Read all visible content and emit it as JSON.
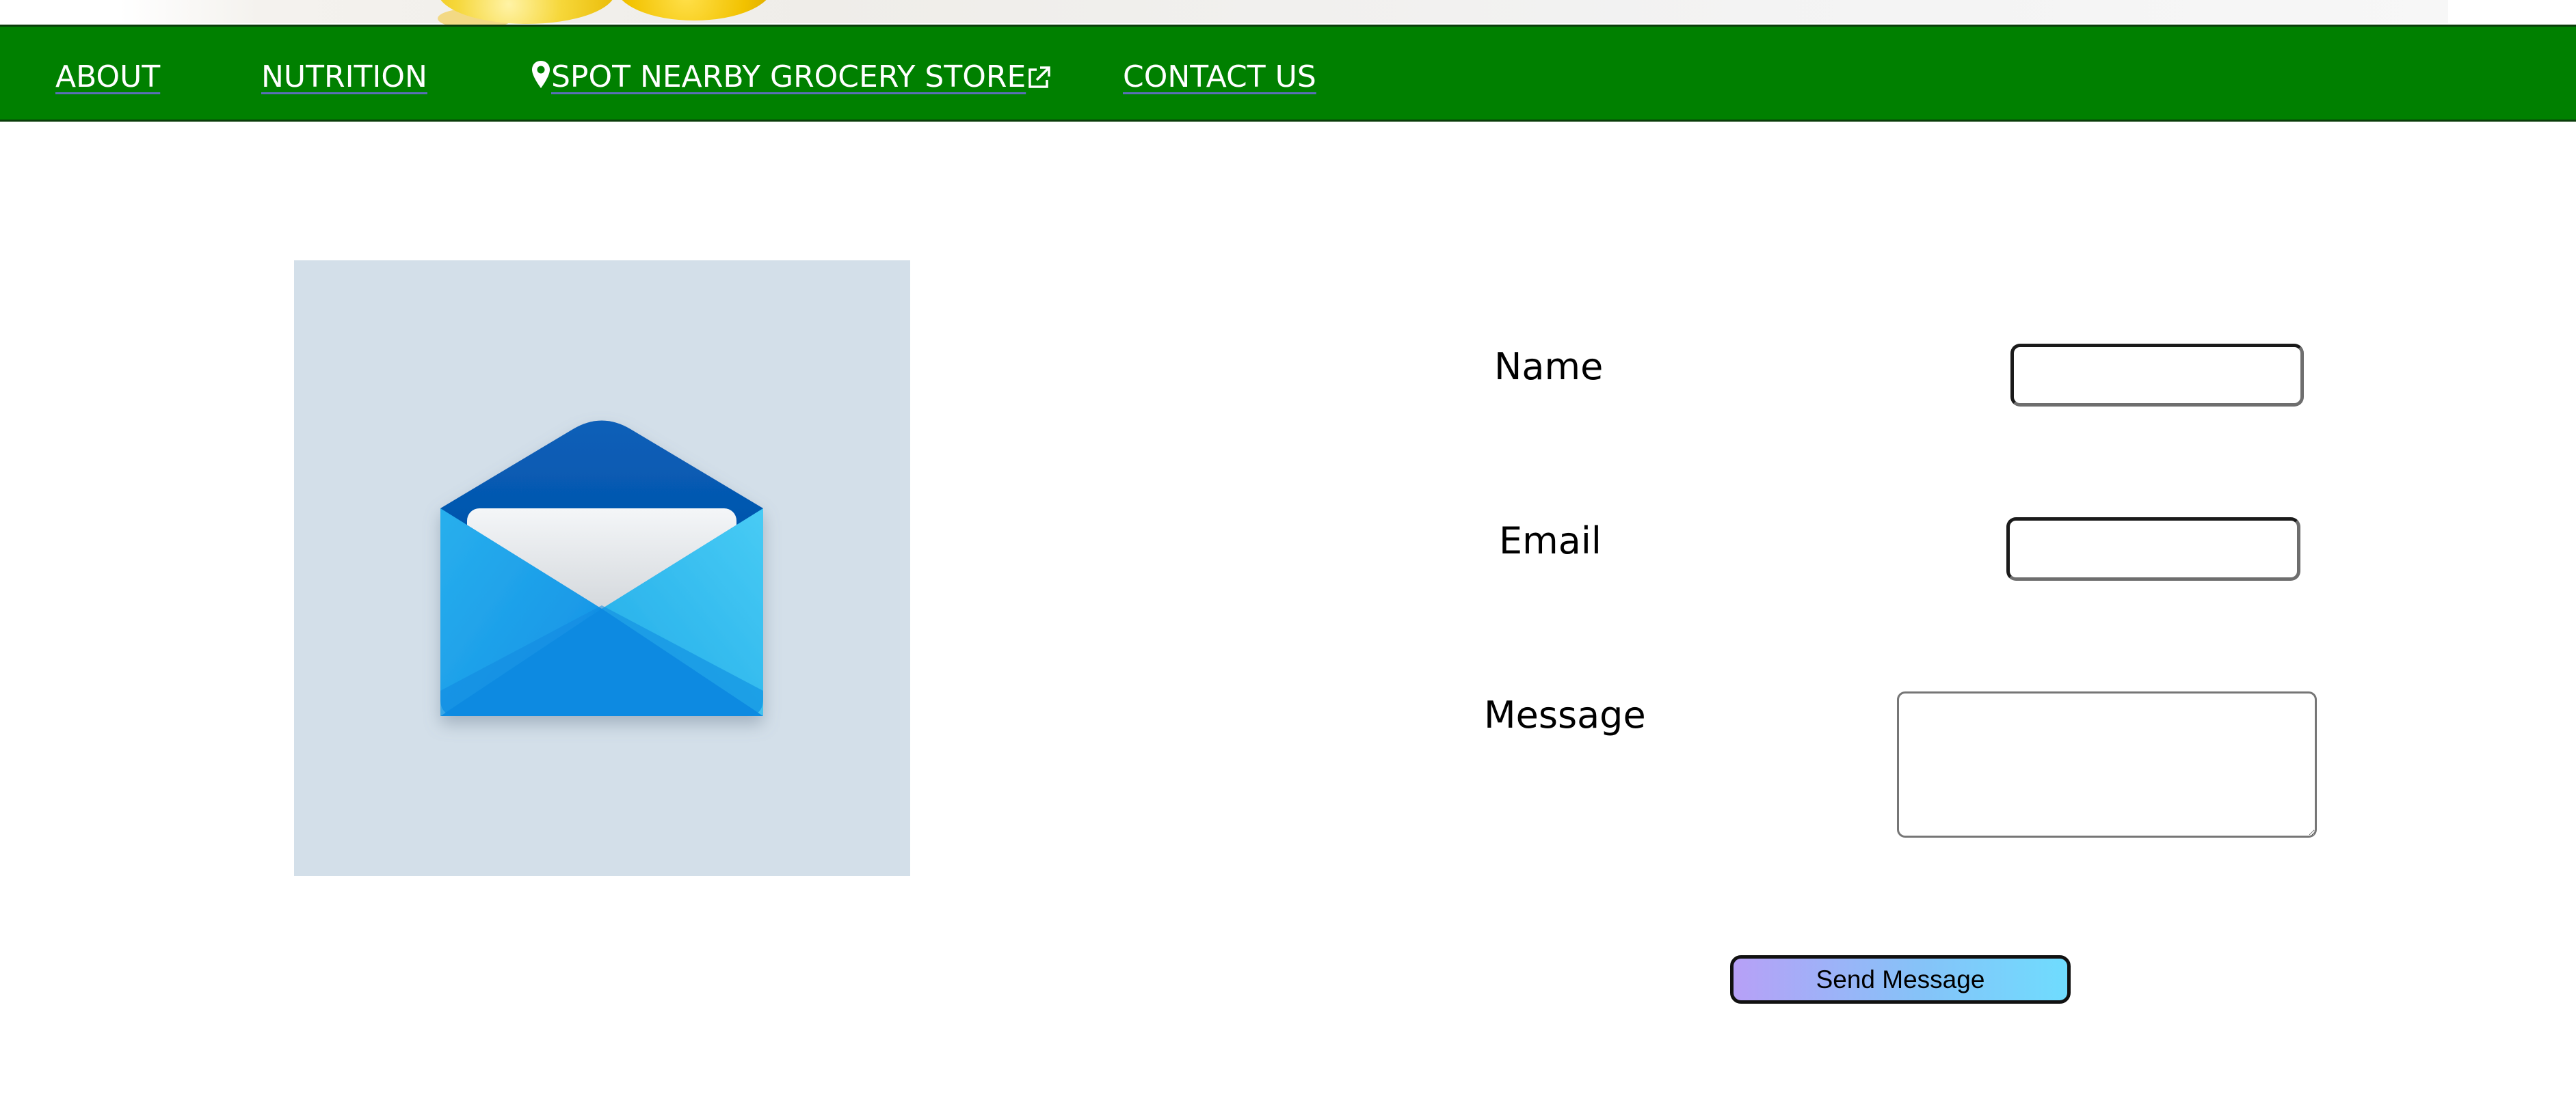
{
  "nav": {
    "about_label": "ABOUT",
    "nutrition_label": "NUTRITION",
    "grocery_label": "SPOT NEARBY GROCERY STORE",
    "contact_label": "CONTACT US"
  },
  "form": {
    "name_label": "Name",
    "name_value": "",
    "email_label": "Email",
    "email_value": "",
    "message_label": "Message",
    "message_value": "",
    "send_label": "Send Message"
  },
  "icons": {
    "location": "map-pin-icon",
    "external_link": "external-link-icon",
    "mail": "open-envelope-icon"
  },
  "colors": {
    "nav_background": "#008000",
    "illustration_background": "#d3dfe9",
    "button_gradient_start": "#b7a0f7",
    "button_gradient_end": "#6fdcfe"
  }
}
